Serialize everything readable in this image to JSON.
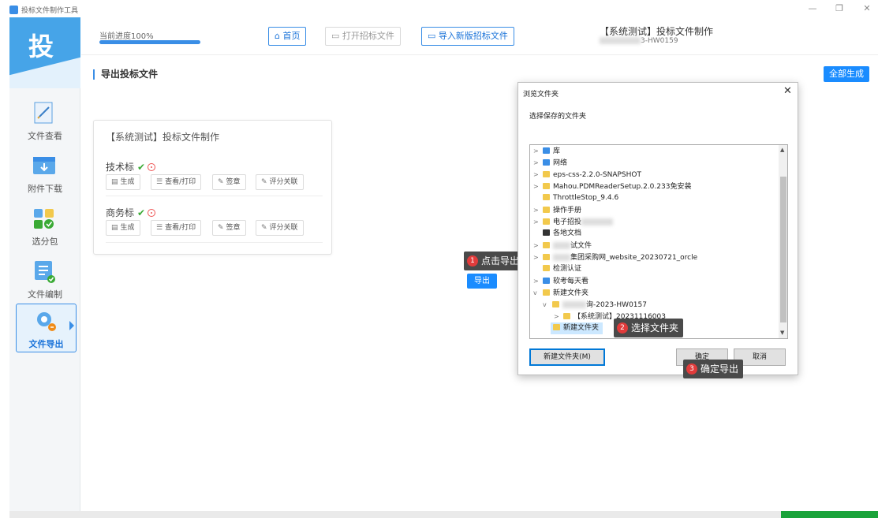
{
  "window": {
    "title": "投标文件制作工具",
    "controls": [
      "—",
      "❐",
      "✕"
    ]
  },
  "sidebar": {
    "logo": "投",
    "items": [
      {
        "label": "文件查看",
        "icon": "file-view-icon"
      },
      {
        "label": "附件下载",
        "icon": "download-icon"
      },
      {
        "label": "选分包",
        "icon": "package-select-icon"
      },
      {
        "label": "文件编制",
        "icon": "file-edit-icon"
      },
      {
        "label": "文件导出",
        "icon": "file-export-icon",
        "active": true
      }
    ]
  },
  "header": {
    "progress_label": "当前进度100%",
    "progress": 1.0,
    "home": "首页",
    "open": "打开招标文件",
    "import": "导入新版招标文件",
    "doc_title": "【系统测试】投标文件制作",
    "doc_code": "3-HW0159"
  },
  "main": {
    "section_title": "导出投标文件",
    "generate_all": "全部生成",
    "card": {
      "title": "【系统测试】投标文件制作",
      "groups": [
        {
          "label": "技术标"
        },
        {
          "label": "商务标"
        }
      ],
      "actions": {
        "generate": "生成",
        "view": "查看/打印",
        "sign": "签章",
        "link": "评分关联"
      }
    },
    "export_label": "导出"
  },
  "tips": [
    {
      "num": "1",
      "text": "点击导出"
    },
    {
      "num": "2",
      "text": "选择文件夹"
    },
    {
      "num": "3",
      "text": "确定导出"
    }
  ],
  "dialog": {
    "title": "浏览文件夹",
    "prompt": "选择保存的文件夹",
    "tree": [
      {
        "text": "库",
        "toggle": ">"
      },
      {
        "text": "网络",
        "toggle": ">"
      },
      {
        "text": "eps-css-2.2.0-SNAPSHOT",
        "toggle": ">"
      },
      {
        "text": "Mahou.PDMReaderSetup.2.0.233免安装",
        "toggle": ">"
      },
      {
        "text": "ThrottleStop_9.4.6",
        "toggle": ""
      },
      {
        "text": "操作手册",
        "toggle": ">"
      },
      {
        "text": "电子招投",
        "toggle": ">"
      },
      {
        "text": "各地文档",
        "toggle": ""
      },
      {
        "text": "试文件",
        "toggle": ">"
      },
      {
        "text": "集团采购网_website_20230721_orcle",
        "toggle": ">"
      },
      {
        "text": "检测认证",
        "toggle": ""
      },
      {
        "text": "软考每天看",
        "toggle": ">"
      },
      {
        "text": "新建文件夹",
        "toggle": "v"
      },
      {
        "text": "询-2023-HW0157",
        "toggle": "v"
      },
      {
        "text": "【系统测试】20231116003",
        "toggle": ">"
      },
      {
        "text": "新建文件夹",
        "toggle": ""
      }
    ],
    "new_folder": "新建文件夹(M)",
    "ok": "确定",
    "cancel": "取消"
  }
}
